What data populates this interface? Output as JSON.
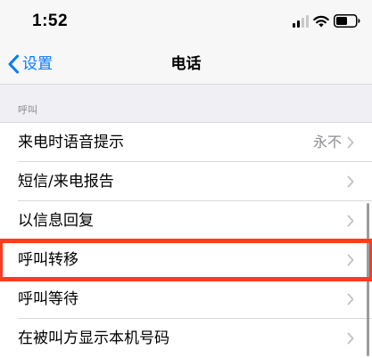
{
  "status_bar": {
    "time": "1:52"
  },
  "nav": {
    "back_label": "设置",
    "title": "电话"
  },
  "section": {
    "header": "呼叫"
  },
  "rows": [
    {
      "label": "来电时语音提示",
      "value": "永不"
    },
    {
      "label": "短信/来电报告",
      "value": ""
    },
    {
      "label": "以信息回复",
      "value": ""
    },
    {
      "label": "呼叫转移",
      "value": "",
      "highlighted": true
    },
    {
      "label": "呼叫等待",
      "value": ""
    },
    {
      "label": "在被叫方显示本机号码",
      "value": ""
    }
  ],
  "colors": {
    "accent": "#007aff",
    "highlight": "#ff3b20",
    "secondary_text": "#8e8e93",
    "group_background": "#efeff4"
  },
  "icons": {
    "signal": "cellular-signal-icon",
    "wifi": "wifi-icon",
    "battery": "battery-icon",
    "back": "chevron-left-icon",
    "disclosure": "chevron-right-icon"
  }
}
